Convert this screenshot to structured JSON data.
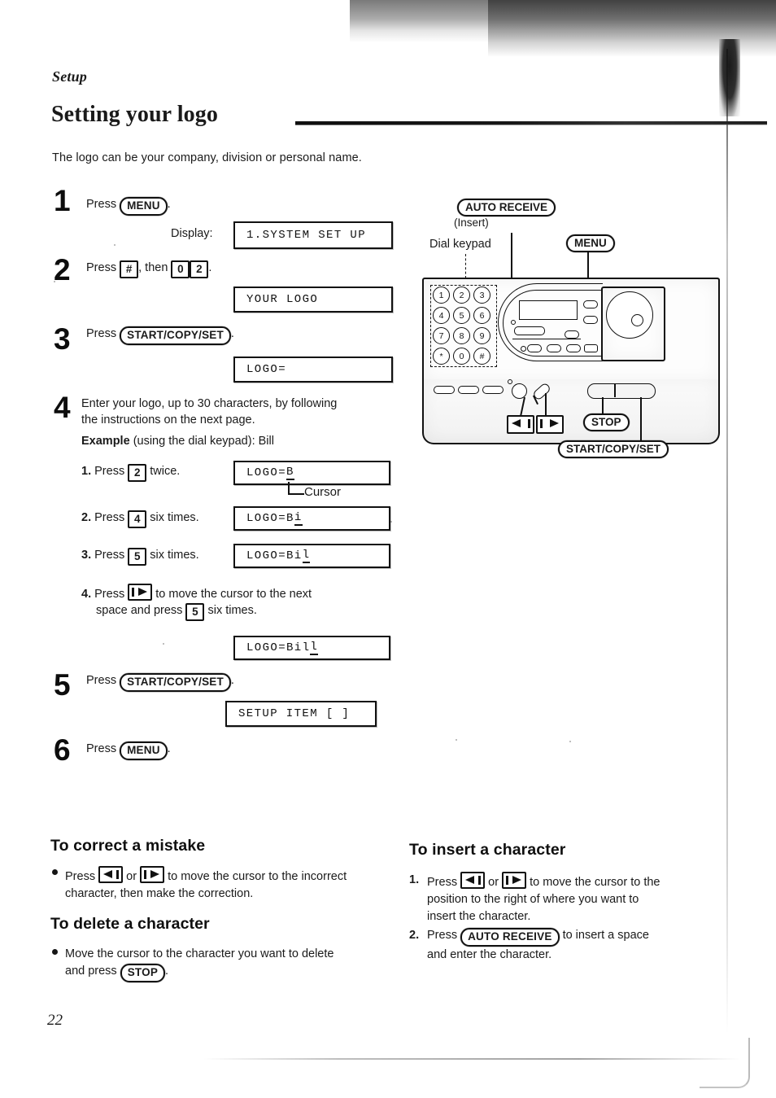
{
  "document": {
    "running_head": "Setup",
    "title": "Setting your logo",
    "intro": "The logo can be your company, division or personal name.",
    "page_number": "22"
  },
  "steps": [
    {
      "num": "1",
      "text_before": "Press",
      "key": "MENU",
      "text_after": ".",
      "display_label": "Display:",
      "display_value": "1.SYSTEM SET UP"
    },
    {
      "num": "2",
      "text_before": "Press",
      "key_hash": "#",
      "text_mid": ", then",
      "key_0": "0",
      "key_2": "2",
      "text_after": ".",
      "display_value": "YOUR LOGO"
    },
    {
      "num": "3",
      "text_before": "Press",
      "key": "START/COPY/SET",
      "text_after": ".",
      "display_value": "LOGO="
    },
    {
      "num": "4",
      "line1": "Enter your logo, up to 30 characters, by following",
      "line2": "the instructions on the next page.",
      "example_bold": "Example",
      "example_rest": "(using the dial keypad):  Bill",
      "substeps": [
        {
          "n": "1.",
          "pre": "Press",
          "key": "2",
          "post": "twice.",
          "display_static": "LOGO=",
          "display_cursor": "B",
          "callout": "Cursor"
        },
        {
          "n": "2.",
          "pre": "Press",
          "key": "4",
          "post": "six times.",
          "display_static": "LOGO=B",
          "display_cursor": "i"
        },
        {
          "n": "3.",
          "pre": "Press",
          "key": "5",
          "post": "six times.",
          "display_static": "LOGO=Bi",
          "display_cursor": "l"
        },
        {
          "n": "4.",
          "pre": "Press",
          "key_icon": "right-arrow",
          "post_line1": "to move the cursor to the next",
          "post_line2_pre": "space and press",
          "key2": "5",
          "post_line2_post": "six times.",
          "display_static": "LOGO=Bil",
          "display_cursor": "l"
        }
      ]
    },
    {
      "num": "5",
      "text_before": "Press",
      "key": "START/COPY/SET",
      "text_after": ".",
      "display_value": "SETUP ITEM [    ]"
    },
    {
      "num": "6",
      "text_before": "Press",
      "key": "MENU",
      "text_after": "."
    }
  ],
  "diagram": {
    "callouts": {
      "auto_receive": "AUTO RECEIVE",
      "auto_receive_sub": "(Insert)",
      "dial_keypad": "Dial keypad",
      "menu": "MENU",
      "stop": "STOP",
      "start_copy_set": "START/COPY/SET"
    },
    "keypad_keys": [
      "1",
      "2",
      "3",
      "4",
      "5",
      "6",
      "7",
      "8",
      "9",
      "*",
      "0",
      "#"
    ]
  },
  "sections": [
    {
      "id": "correct",
      "heading": "To correct a mistake",
      "bullet": {
        "pre": "Press",
        "icon_left": "left-arrow",
        "mid": "or",
        "icon_right": "right-arrow",
        "post_line1": "to move the cursor to the incorrect",
        "post_line2": "character, then make the correction."
      }
    },
    {
      "id": "delete",
      "heading": "To delete a character",
      "bullet": {
        "line1": "Move the cursor to the character you want to delete",
        "line2_pre": "and press",
        "key": "STOP",
        "line2_post": "."
      }
    },
    {
      "id": "insert",
      "heading": "To insert a character",
      "items": [
        {
          "n": "1.",
          "pre": "Press",
          "icon_left": "left-arrow",
          "mid": "or",
          "icon_right": "right-arrow",
          "l1": "to move the cursor to the",
          "l2": "position to the right of where you want to",
          "l3": "insert the character."
        },
        {
          "n": "2.",
          "pre": "Press",
          "key": "AUTO RECEIVE",
          "l1": "to insert a space",
          "l2": "and enter the character."
        }
      ]
    }
  ]
}
